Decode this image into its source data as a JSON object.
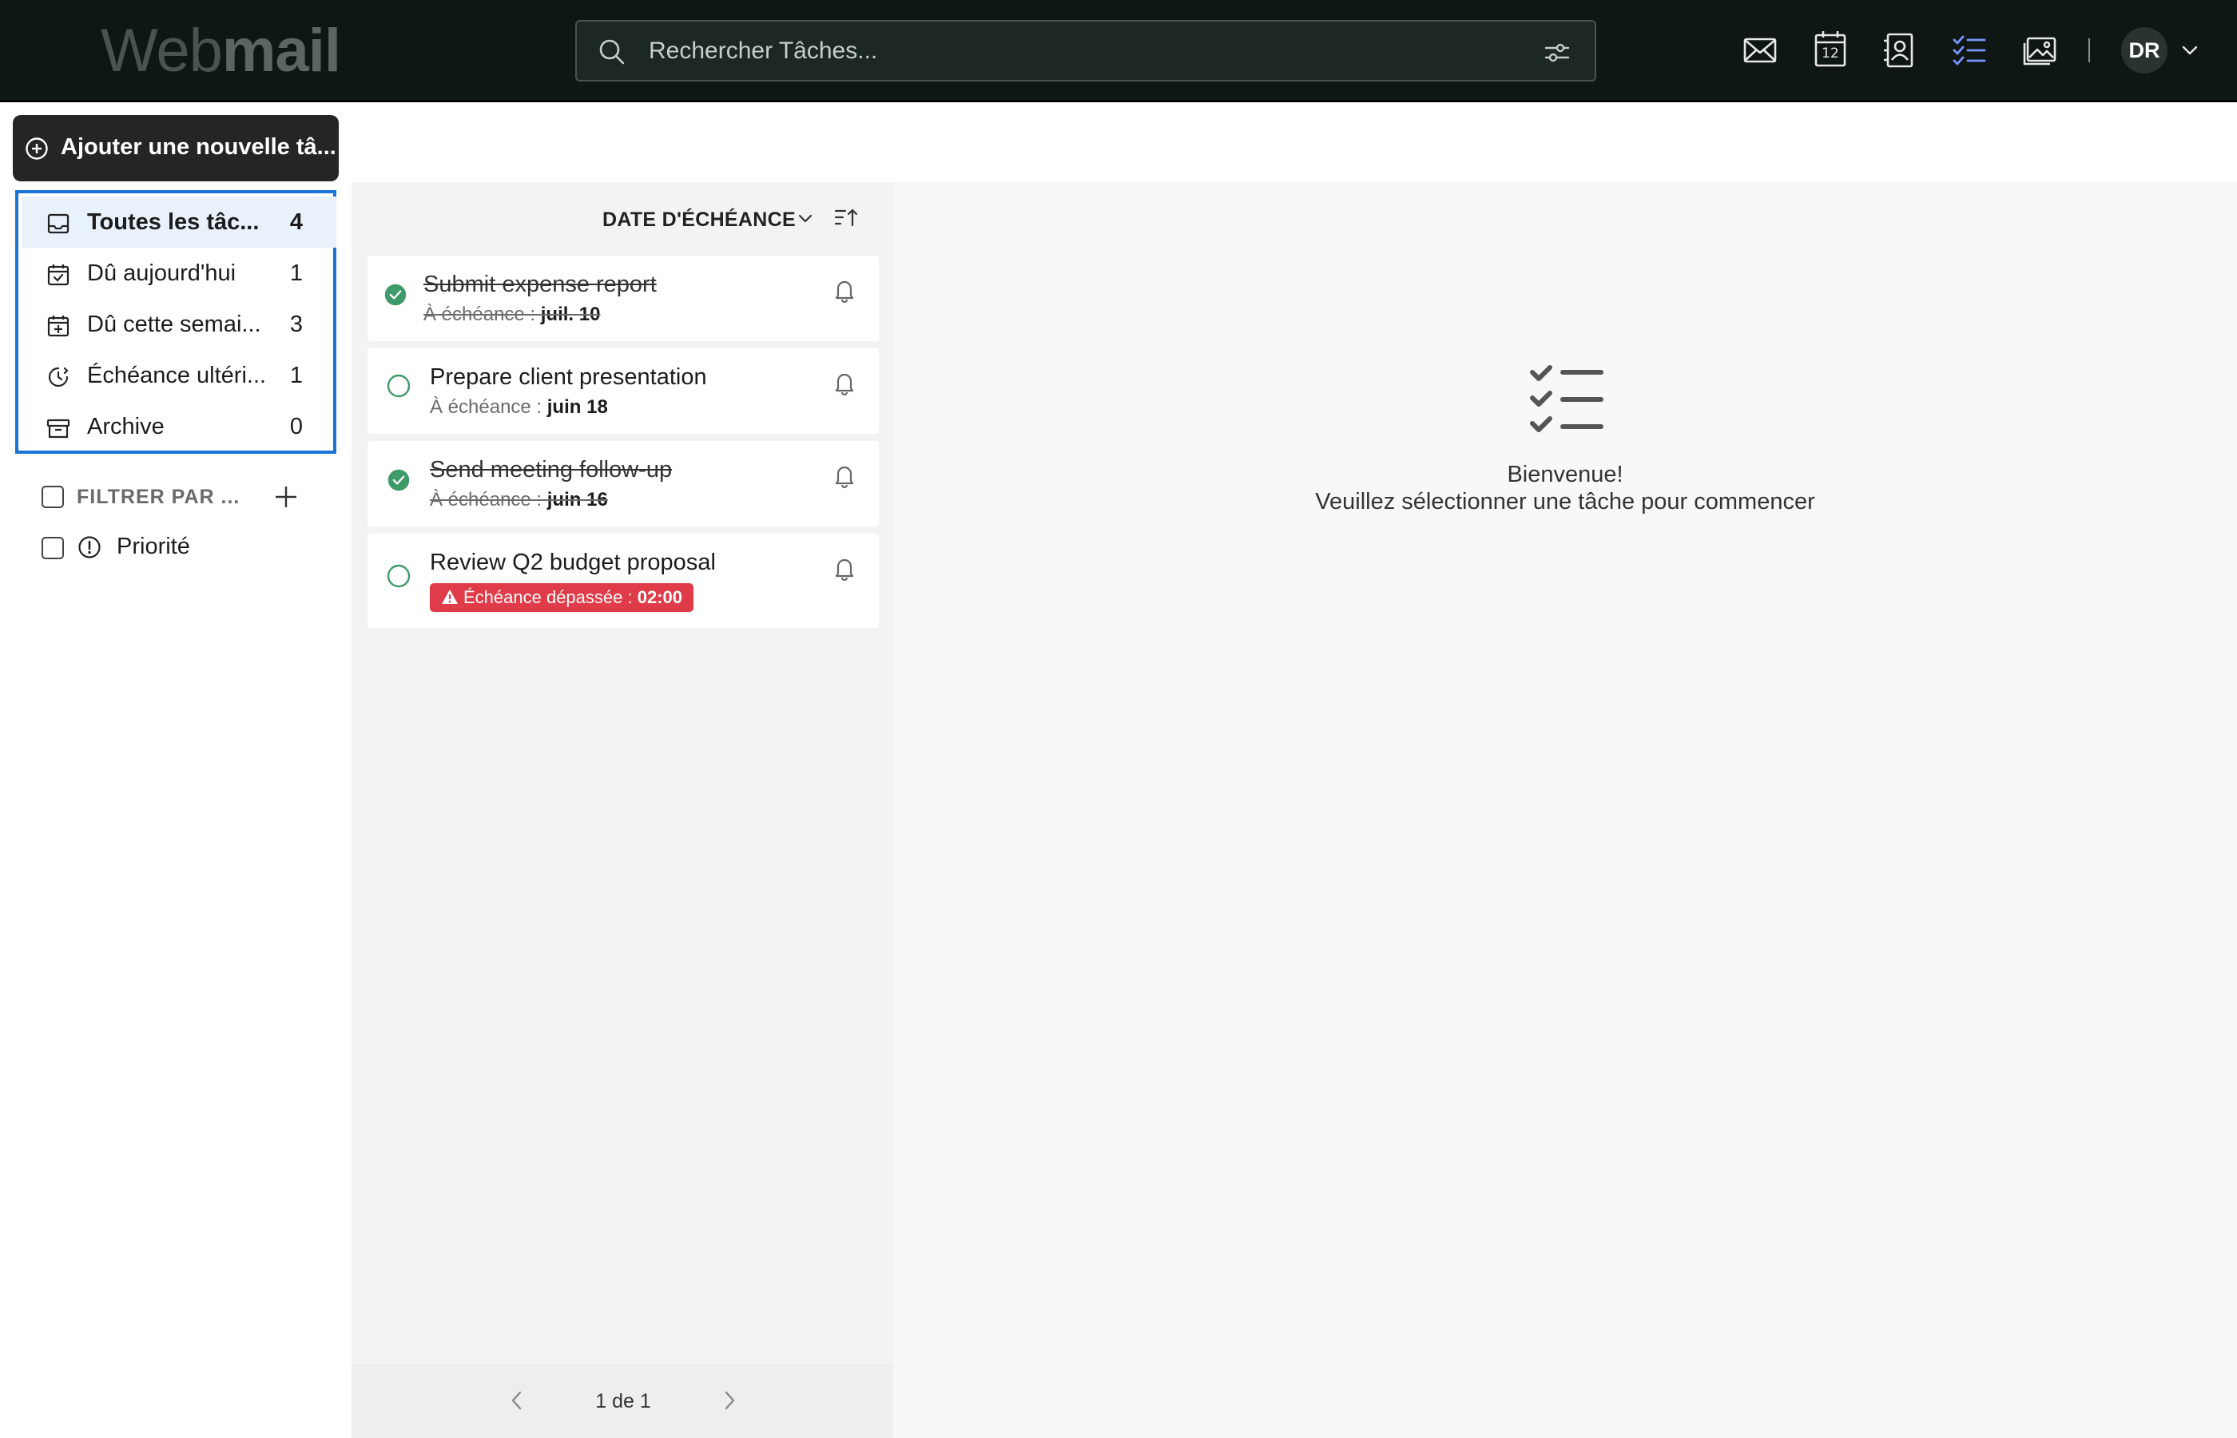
{
  "header": {
    "logo_light": "Web",
    "logo_bold": "mail",
    "search_placeholder": "Rechercher Tâches...",
    "apps": [
      "mail-icon",
      "calendar-icon",
      "contacts-icon",
      "tasks-icon",
      "photos-icon"
    ],
    "calendar_day": "12",
    "avatar_initials": "DR",
    "active_app_color": "#7b95ff"
  },
  "sidebar": {
    "add_button_label": "Ajouter une nouvelle tâ...",
    "folders": [
      {
        "label": "Toutes les tâc...",
        "count": "4",
        "icon": "inbox-icon"
      },
      {
        "label": "Dû aujourd'hui",
        "count": "1",
        "icon": "calendar-check-icon"
      },
      {
        "label": "Dû cette semai...",
        "count": "3",
        "icon": "calendar-week-icon"
      },
      {
        "label": "Échéance ultéri...",
        "count": "1",
        "icon": "clock-later-icon"
      },
      {
        "label": "Archive",
        "count": "0",
        "icon": "archive-icon"
      }
    ],
    "filter_label": "FILTRER PAR ...",
    "filters": [
      {
        "label": "Priorité",
        "icon": "priority-icon"
      }
    ],
    "selection_color": "#1a73d9"
  },
  "task_list": {
    "sort_label": "DATE D'ÉCHÉANCE",
    "tasks": [
      {
        "title": "Submit expense report",
        "due_prefix": "À échéance : ",
        "due_date": "juil. 10",
        "done": true
      },
      {
        "title": "Prepare client presentation",
        "due_prefix": "À échéance : ",
        "due_date": "juin 18",
        "done": false
      },
      {
        "title": "Send meeting follow-up",
        "due_prefix": "À échéance : ",
        "due_date": "juin 16",
        "done": true
      },
      {
        "title": "Review Q2 budget proposal",
        "overdue_prefix": "Échéance dépassée : ",
        "overdue_time": "02:00",
        "done": false
      }
    ],
    "pager_text": "1 de 1",
    "done_color": "#3f9a6a",
    "overdue_color": "#e03b48"
  },
  "detail": {
    "welcome_title": "Bienvenue!",
    "welcome_subtitle": "Veuillez sélectionner une tâche pour commencer"
  }
}
